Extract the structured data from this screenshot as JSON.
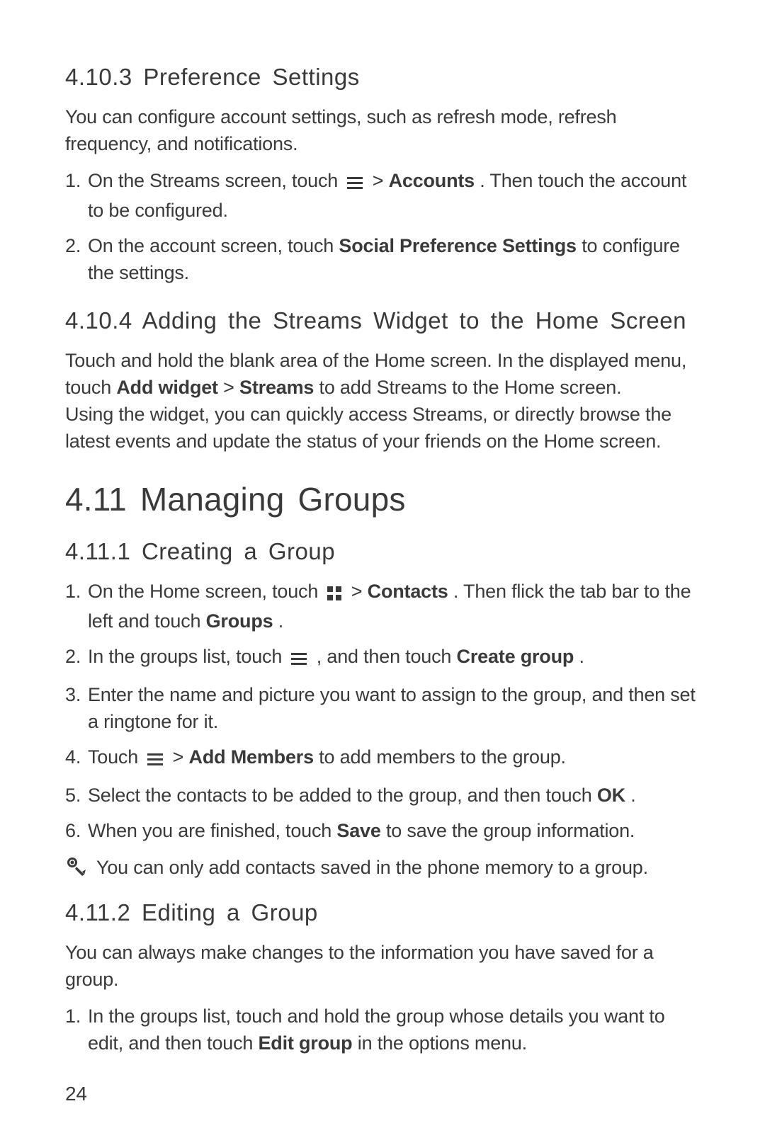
{
  "sections": {
    "s1": {
      "heading": "4.10.3  Preference Settings",
      "intro": "You can configure account settings, such as refresh mode, refresh frequency, and notifications.",
      "list": [
        {
          "n": "1.",
          "pre": "On the Streams screen, touch ",
          "mid1": " > ",
          "b1": "Accounts",
          "post": ". Then touch the account to be configured."
        },
        {
          "n": "2.",
          "pre": "On the account screen, touch ",
          "b1": "Social Preference Settings",
          "post": " to configure the settings."
        }
      ]
    },
    "s2": {
      "heading": "4.10.4  Adding the Streams Widget to the Home Screen",
      "p1_pre": "Touch and hold the blank area of the Home screen. In the displayed menu, touch ",
      "p1_b1": "Add widget",
      "p1_mid": " > ",
      "p1_b2": "Streams",
      "p1_post": " to add Streams to the Home screen.",
      "p2": "Using the widget, you can quickly access Streams, or directly browse the latest events and update the status of your friends on the Home screen."
    },
    "s3": {
      "heading": "4.11  Managing Groups"
    },
    "s4": {
      "heading": "4.11.1  Creating a Group",
      "list": [
        {
          "n": "1.",
          "pre": "On the Home screen, touch ",
          "mid1": " > ",
          "b1": "Contacts",
          "mid2": ". Then flick the tab bar to the left and touch ",
          "b2": "Groups",
          "post": "."
        },
        {
          "n": "2.",
          "pre": "In the groups list, touch ",
          "mid1": " , and then touch ",
          "b1": "Create group",
          "post": "."
        },
        {
          "n": "3.",
          "text": "Enter the name and picture you want to assign to the group, and then set a ringtone for it."
        },
        {
          "n": "4.",
          "pre": "Touch ",
          "mid1": " > ",
          "b1": "Add Members",
          "post": " to add members to the group."
        },
        {
          "n": "5.",
          "pre": "Select the contacts to be added to the group, and then touch ",
          "b1": "OK",
          "post": "."
        },
        {
          "n": "6.",
          "pre": "When you are finished, touch ",
          "b1": "Save",
          "post": " to save the group information."
        }
      ],
      "note": "You can only add contacts saved in the phone memory to a group."
    },
    "s5": {
      "heading": "4.11.2  Editing a Group",
      "intro": "You can always make changes to the information you have saved for a group.",
      "list": [
        {
          "n": "1.",
          "pre": "In the groups list, touch and hold the group whose details you want to edit, and then touch ",
          "b1": "Edit group",
          "post": " in the options menu."
        }
      ]
    }
  },
  "pageNumber": "24"
}
